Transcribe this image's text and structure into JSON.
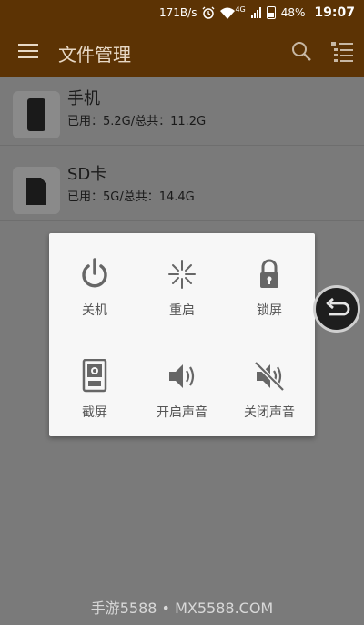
{
  "status_bar": {
    "net_speed": "171B/s",
    "network_type": "4G",
    "battery": "48%",
    "time": "19:07",
    "icons": [
      "alarm-icon",
      "wifi-icon",
      "signal-icon",
      "battery-icon"
    ]
  },
  "app_bar": {
    "title": "文件管理",
    "icons": [
      "menu-icon",
      "search-icon",
      "list-view-icon"
    ]
  },
  "storage": [
    {
      "name": "手机",
      "usage": "已用：5.2G/总共：11.2G",
      "icon": "phone-icon"
    },
    {
      "name": "SD卡",
      "usage": "已用：5G/总共：14.4G",
      "icon": "sd-card-icon"
    }
  ],
  "power_menu": {
    "options": [
      {
        "label": "关机",
        "icon": "power-icon"
      },
      {
        "label": "重启",
        "icon": "restart-icon"
      },
      {
        "label": "锁屏",
        "icon": "lock-icon"
      },
      {
        "label": "截屏",
        "icon": "screenshot-icon"
      },
      {
        "label": "开启声音",
        "icon": "sound-on-icon"
      },
      {
        "label": "关闭声音",
        "icon": "sound-off-icon"
      }
    ]
  },
  "floating_button": {
    "icon": "back-icon"
  },
  "watermark": "手游5588 • MX5588.COM",
  "colors": {
    "app_bar": "#5c3304",
    "overlay": "#7a7a7a",
    "dialog": "#f7f7f7"
  }
}
